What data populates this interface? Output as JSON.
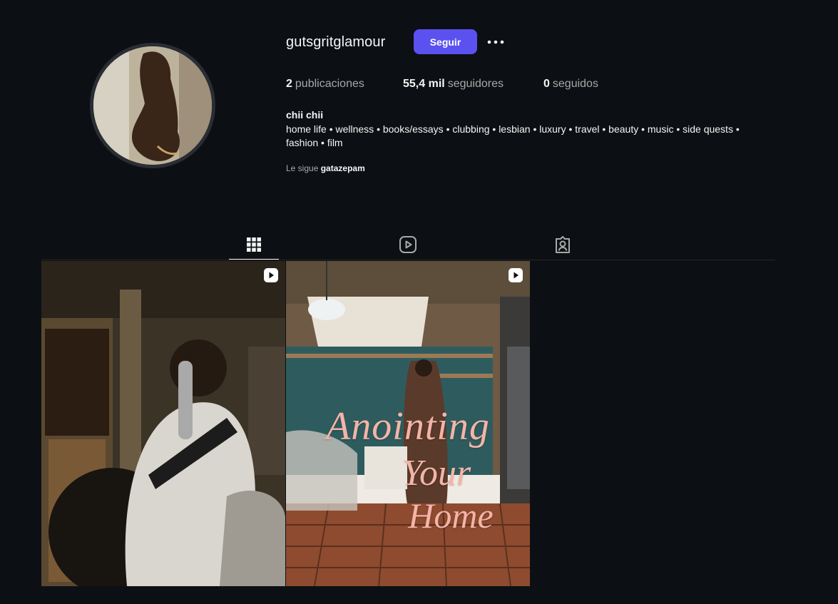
{
  "profile": {
    "username": "gutsgritglamour",
    "follow_label": "Seguir",
    "more_icon": "more-horizontal-icon",
    "full_name": "chii chii",
    "bio": "home life • wellness • books/essays • clubbing • lesbian • luxury • travel • beauty • music • side quests • fashion • film",
    "followed_by_prefix": "Le sigue",
    "followed_by_user": "gatazepam"
  },
  "stats": {
    "posts_count": "2",
    "posts_label": "publicaciones",
    "followers_count": "55,4 mil",
    "followers_label": "seguidores",
    "following_count": "0",
    "following_label": "seguidos"
  },
  "tabs": [
    {
      "name": "posts",
      "icon": "grid-icon",
      "active": true
    },
    {
      "name": "reels",
      "icon": "reels-icon",
      "active": false
    },
    {
      "name": "tagged",
      "icon": "tagged-icon",
      "active": false
    }
  ],
  "posts": [
    {
      "type": "reel",
      "icon": "reel-icon"
    },
    {
      "type": "reel",
      "icon": "reel-icon",
      "overlay_lines": [
        "Anointing",
        "Your",
        "Home"
      ]
    }
  ],
  "colors": {
    "background": "#0c1014",
    "accent": "#5b51f0",
    "overlay_text": "#f3b4a8"
  }
}
